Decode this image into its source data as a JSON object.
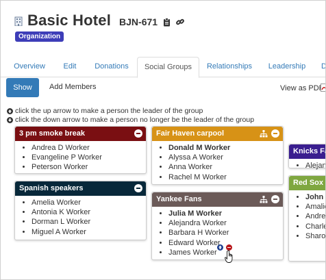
{
  "header": {
    "title": "Basic Hotel",
    "code": "BJN-671",
    "badge": "Organization"
  },
  "tabs": [
    {
      "label": "Overview",
      "active": false
    },
    {
      "label": "Edit",
      "active": false
    },
    {
      "label": "Donations",
      "active": false
    },
    {
      "label": "Social Groups",
      "active": true
    },
    {
      "label": "Relationships",
      "active": false
    },
    {
      "label": "Leadership",
      "active": false
    },
    {
      "label": "D",
      "active": false
    }
  ],
  "toolbar": {
    "show_label": "Show",
    "add_members_label": "Add Members",
    "view_pdf_label": "View as PDF"
  },
  "help": {
    "up": "click the up arrow to make a person the leader of the group",
    "down": "click the down arrow to make a person no longer be the leader of the group"
  },
  "groups": [
    {
      "name": "3 pm smoke break",
      "color": "#7a0f12",
      "members": [
        "Andrea D Worker",
        "Evangeline P Worker",
        "Peterson Worker"
      ]
    },
    {
      "name": "Spanish speakers",
      "color": "#08283a",
      "members": [
        "Amelia Worker",
        "Antonia K Worker",
        "Dorman L Worker",
        "Miguel A Worker"
      ]
    },
    {
      "name": "Fair Haven carpool",
      "color": "#d79216",
      "leader": "Donald M Worker",
      "members": [
        "Alyssa A Worker",
        "Anna Worker",
        "Rachel M Worker"
      ]
    },
    {
      "name": "Yankee Fans",
      "color": "#6b5a58",
      "leader": "Julia M Worker",
      "members": [
        "Alejandra Worker",
        "Barbara H Worker",
        "Edward Worker",
        "James Worker"
      ]
    },
    {
      "name": "Knicks Fan",
      "color": "#3a1e8f",
      "members": [
        "Alejand"
      ]
    },
    {
      "name": "Red Sox F",
      "color": "#7fa740",
      "leader": "John H",
      "members": [
        "Amalic",
        "Andrew",
        "Charle",
        "Sharon"
      ]
    }
  ]
}
